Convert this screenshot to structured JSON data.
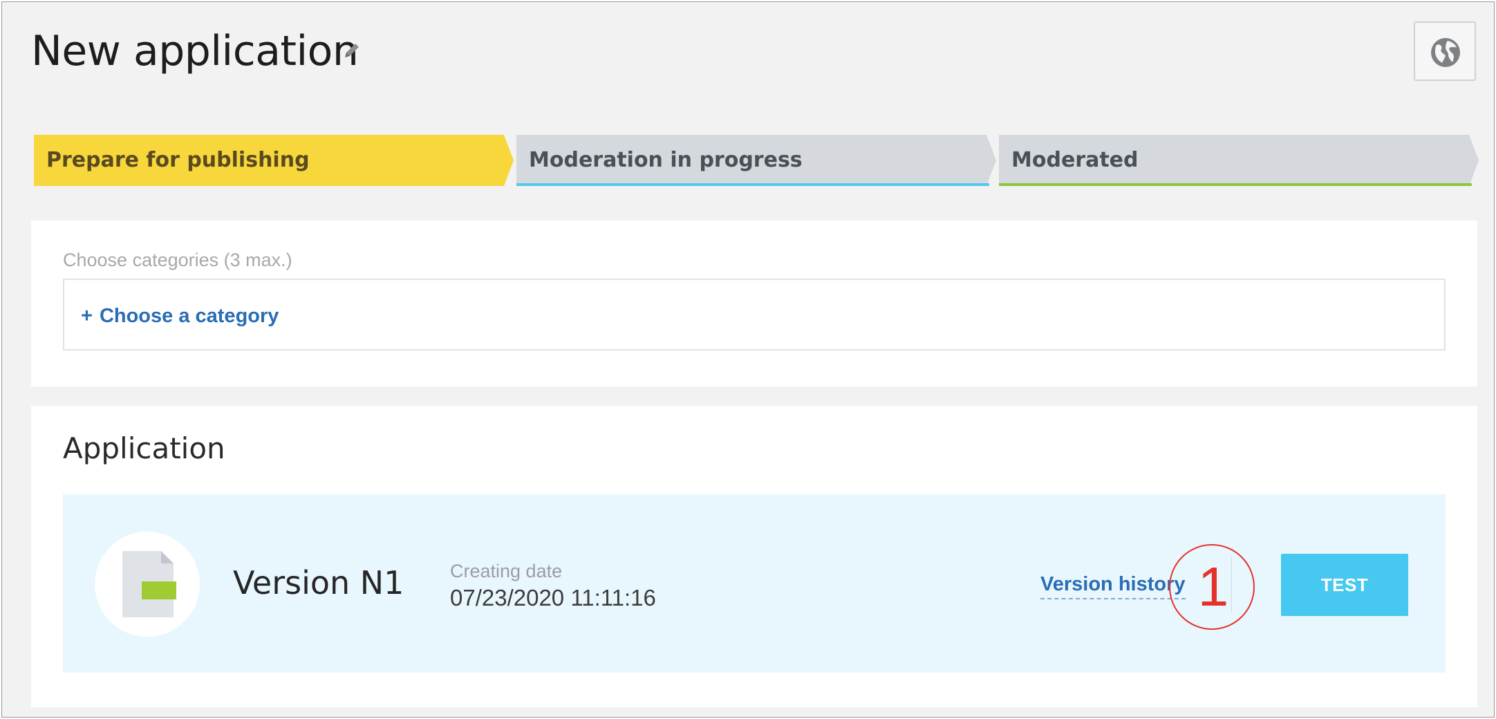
{
  "header": {
    "title": "New application",
    "edit_icon": "pencil-icon",
    "language_icon": "globe-icon"
  },
  "steps": [
    {
      "label": "Prepare for publishing",
      "state": "active",
      "color": "#f7d73c",
      "underline": "#f7d73c"
    },
    {
      "label": "Moderation in progress",
      "state": "pending",
      "color": "#d5d8dd",
      "underline": "#4fc9ee"
    },
    {
      "label": "Moderated",
      "state": "pending",
      "color": "#d5d8dd",
      "underline": "#8cc63e"
    }
  ],
  "categories": {
    "label": "Choose categories (3 max.)",
    "add_link_plus": "+",
    "add_link": "Choose a category"
  },
  "application": {
    "title": "Application",
    "version": {
      "file_icon": "file-icon",
      "name": "Version N1",
      "date_label": "Creating date",
      "date_value": "07/23/2020 11:11:16",
      "history_link": "Version history",
      "annotation_number": "1",
      "test_button": "TEST"
    }
  },
  "colors": {
    "accent_link": "#2a6db5",
    "test_button": "#46c8f0",
    "annotation": "#e4322b",
    "panel_bg": "#e8f7fd"
  }
}
